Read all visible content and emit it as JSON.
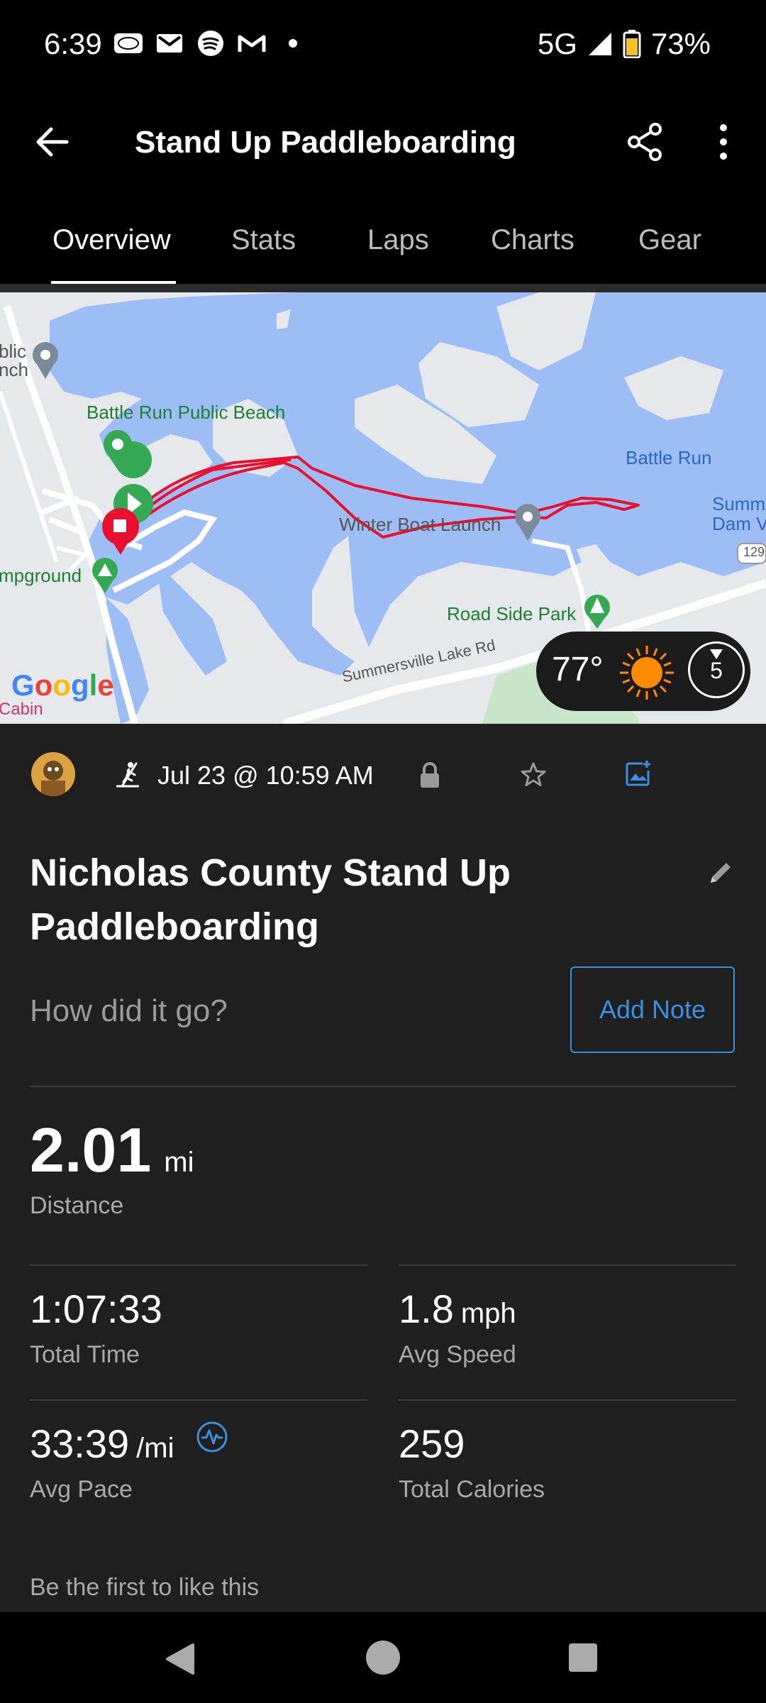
{
  "status_bar": {
    "time": "6:39",
    "notification_icons": [
      "ford-icon",
      "gmail-icon",
      "spotify-icon",
      "gmail-m-icon",
      "dot-icon"
    ],
    "network": "5G",
    "battery": "73%"
  },
  "app_bar": {
    "title": "Stand Up Paddleboarding"
  },
  "tabs": [
    {
      "label": "Overview",
      "active": true
    },
    {
      "label": "Stats",
      "active": false
    },
    {
      "label": "Laps",
      "active": false
    },
    {
      "label": "Charts",
      "active": false
    },
    {
      "label": "Gear",
      "active": false
    }
  ],
  "map": {
    "labels": {
      "public_branch": "blic\nnch",
      "beach": "Battle Run Public Beach",
      "battle_run": "Battle Run",
      "winter_boat_launch": "Winter Boat Launch",
      "summ_dam_view": "Summ\nDam Vie",
      "road_number": "129",
      "campground": "mpground",
      "road_side_park": "Road Side Park",
      "road": "Summersville Lake Rd",
      "cabin": "Cabin",
      "google": "Google"
    },
    "weather": {
      "temperature": "77°",
      "wind": "5"
    }
  },
  "activity": {
    "date": "Jul 23 @ 10:59 AM",
    "title": "Nicholas County Stand Up Paddleboarding",
    "note_prompt": "How did it go?",
    "add_note_label": "Add Note"
  },
  "stats": {
    "distance": {
      "value": "2.01",
      "unit": "mi",
      "label": "Distance"
    },
    "total_time": {
      "value": "1:07:33",
      "label": "Total Time"
    },
    "avg_speed": {
      "value": "1.8",
      "unit": "mph",
      "label": "Avg Speed"
    },
    "avg_pace": {
      "value": "33:39",
      "unit": "/mi",
      "label": "Avg Pace"
    },
    "total_calories": {
      "value": "259",
      "label": "Total Calories"
    }
  },
  "likes_text": "Be the first to like this",
  "colors": {
    "accent": "#3b8fe0",
    "route": "#e8102e",
    "water": "#9dbdf5",
    "start_marker": "#34a853",
    "sun": "#ff8c00"
  }
}
